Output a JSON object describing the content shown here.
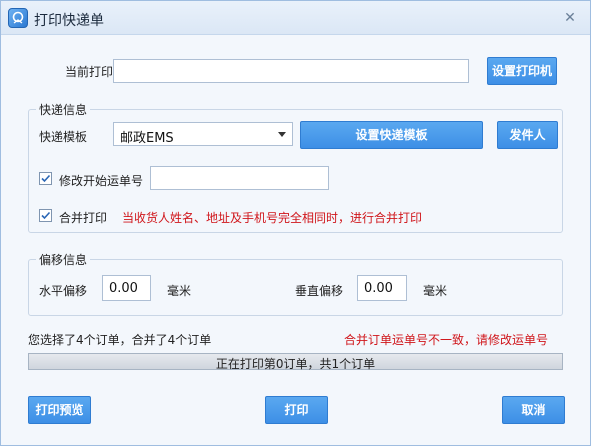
{
  "window": {
    "title": "打印快递单",
    "close_symbol": "✕"
  },
  "printer": {
    "label": "当前打印机",
    "value": "",
    "button": "设置打印机"
  },
  "express": {
    "group_title": "快递信息",
    "template_label": "快递模板",
    "template_selected": "邮政EMS",
    "set_template_button": "设置快递模板",
    "sender_button": "发件人",
    "modify_start": {
      "label": "修改开始运单号",
      "checked": true,
      "value": ""
    },
    "merge_print": {
      "label": "合并打印",
      "checked": true,
      "note": "当收货人姓名、地址及手机号完全相同时，进行合并打印"
    }
  },
  "offset": {
    "group_title": "偏移信息",
    "horizontal_label": "水平偏移",
    "horizontal_value": "0.00",
    "horizontal_unit": "毫米",
    "vertical_label": "垂直偏移",
    "vertical_value": "0.00",
    "vertical_unit": "毫米"
  },
  "status": {
    "selection_text": "您选择了4个订单，合并了4个订单",
    "warning_text": "合并订单运单号不一致，请修改运单号",
    "progress_text": "正在打印第0订单，共1个订单",
    "progress_fraction": 0
  },
  "footer": {
    "preview_button": "打印预览",
    "print_button": "打印",
    "cancel_button": "取消"
  },
  "colors": {
    "accent": "#3d8fe6",
    "warning": "#d0161b",
    "progress": "#7cbd6b"
  }
}
